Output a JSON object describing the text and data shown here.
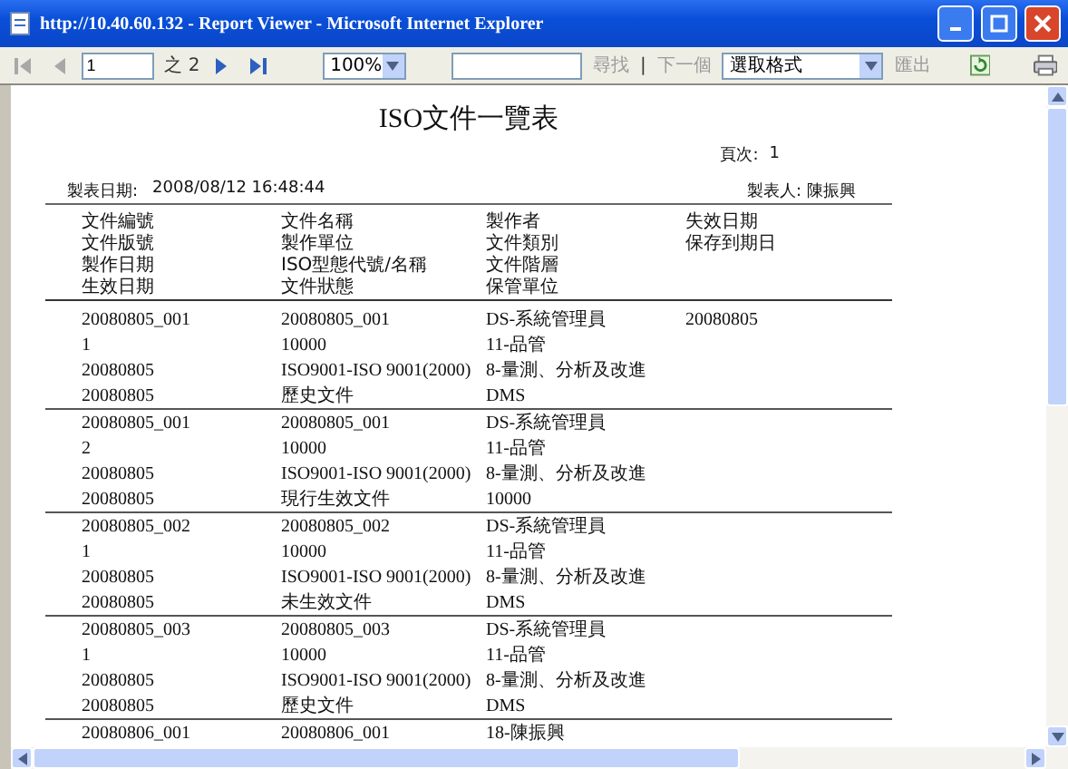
{
  "window": {
    "title": "http://10.40.60.132 - Report Viewer - Microsoft Internet Explorer"
  },
  "toolbar": {
    "nav": [
      {
        "kind": "first",
        "disabled": true
      },
      {
        "kind": "prev",
        "disabled": true
      }
    ],
    "page": "1",
    "of_label": "之 2",
    "nav_after": [
      {
        "kind": "next",
        "disabled": false
      },
      {
        "kind": "last",
        "disabled": false
      }
    ],
    "zoom": "100%",
    "find_label": "尋找",
    "find_disabled": true,
    "separator": "|",
    "next_label": "下一個",
    "format": "選取格式",
    "export_label": "匯出",
    "export_disabled": true
  },
  "report": {
    "title": "ISO文件一覽表",
    "page_label": "頁次:",
    "page": "1",
    "date_label": "製表日期:",
    "date": "2008/08/12 16:48:44",
    "maker_label": "製表人:",
    "maker": "陳振興",
    "header_rows": [
      [
        "文件編號",
        "文件名稱",
        "製作者",
        "失效日期"
      ],
      [
        "文件版號",
        "製作單位",
        "文件類別",
        "保存到期日"
      ],
      [
        "製作日期",
        "ISO型態代號/名稱",
        "文件階層"
      ],
      [
        "生效日期",
        "文件狀態",
        "保管單位"
      ]
    ],
    "records": [
      [
        [
          "20080805_001",
          "20080805_001",
          "DS-系統管理員",
          "20080805"
        ],
        [
          "1",
          "10000",
          "11-品管"
        ],
        [
          "20080805",
          "ISO9001-ISO 9001(2000)",
          "8-量測、分析及改進"
        ],
        [
          "20080805",
          "歷史文件",
          "DMS"
        ]
      ],
      [
        [
          "20080805_001",
          "20080805_001",
          "DS-系統管理員"
        ],
        [
          "2",
          "10000",
          "11-品管"
        ],
        [
          "20080805",
          "ISO9001-ISO 9001(2000)",
          "8-量測、分析及改進"
        ],
        [
          "20080805",
          "現行生效文件",
          "10000"
        ]
      ],
      [
        [
          "20080805_002",
          "20080805_002",
          "DS-系統管理員"
        ],
        [
          "1",
          "10000",
          "11-品管"
        ],
        [
          "20080805",
          "ISO9001-ISO 9001(2000)",
          "8-量測、分析及改進"
        ],
        [
          "20080805",
          "未生效文件",
          "DMS"
        ]
      ],
      [
        [
          "20080805_003",
          "20080805_003",
          "DS-系統管理員"
        ],
        [
          "1",
          "10000",
          "11-品管"
        ],
        [
          "20080805",
          "ISO9001-ISO 9001(2000)",
          "8-量測、分析及改進"
        ],
        [
          "20080805",
          "歷史文件",
          "DMS"
        ]
      ],
      [
        [
          "20080806_001",
          "20080806_001",
          "18-陳振興"
        ]
      ]
    ]
  }
}
